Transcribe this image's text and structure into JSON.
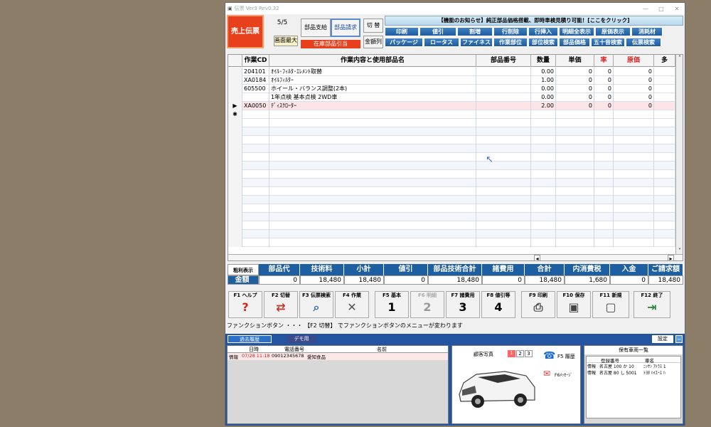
{
  "window": {
    "title": "伝票 Ver3 Rev0.32",
    "controls": [
      "—",
      "□",
      "✕"
    ]
  },
  "header": {
    "sales_slip": "売上伝票",
    "page": "5/5",
    "parts_pay": "部品支給",
    "parts_bill": "部品請求",
    "switch": "切 替",
    "screen_max": "画面最大",
    "stock_draw": "在庫部品引当",
    "all_amounts": "金額列"
  },
  "notice": "【機能のお知らせ】純正部品価格搭載、即時車検見積り可能！[ここをクリック]",
  "toolbar_row1": [
    "印刷",
    "値引",
    "割増",
    "行削除",
    "行挿入",
    "明細全表示",
    "原価表示",
    "消耗材"
  ],
  "toolbar_row2": [
    "パッケージ",
    "ロータス",
    "ファイネス",
    "作業部位",
    "部位検索",
    "部品価格",
    "五十音検索",
    "伝票検索"
  ],
  "grid": {
    "headers": [
      "作業CD",
      "作業内容と使用部品名",
      "部品番号",
      "数量",
      "単価",
      "率",
      "原価",
      "多"
    ],
    "rows": [
      {
        "mark": "",
        "cd": "204101",
        "name": "ｵｲﾙ･ﾌｨﾙﾀ･ｴﾚﾒﾝﾄ取替",
        "part": "",
        "qty": "0.00",
        "price": "0",
        "rate": "0",
        "cost": "0"
      },
      {
        "mark": "",
        "cd": "XA0184",
        "name": "ｵｲﾙﾌｨﾙﾀｰ",
        "part": "",
        "qty": "1.00",
        "price": "0",
        "rate": "0",
        "cost": "0"
      },
      {
        "mark": "",
        "cd": "605500",
        "name": "ホイール・バランス調整(2本)",
        "part": "",
        "qty": "0.00",
        "price": "0",
        "rate": "0",
        "cost": "0"
      },
      {
        "mark": "",
        "cd": "",
        "name": "1年点検 基本点検 2WD車",
        "part": "",
        "qty": "0.00",
        "price": "0",
        "rate": "0",
        "cost": "0"
      },
      {
        "mark": "▶",
        "cd": "XA0050",
        "name": "ﾃﾞｨｽｸﾛｰﾀｰ",
        "part": "",
        "qty": "2.00",
        "price": "0",
        "rate": "0",
        "cost": "0"
      },
      {
        "mark": "✱",
        "cd": "",
        "name": "",
        "part": "",
        "qty": "",
        "price": "",
        "rate": "",
        "cost": ""
      }
    ]
  },
  "totals": {
    "label_top": "粗利表示",
    "label_bottom": "金額",
    "heads": [
      "部品代",
      "技術料",
      "小計",
      "値引",
      "部品技術合計",
      "諸費用",
      "合計",
      "内消費税",
      "入金",
      "ご請求額"
    ],
    "values": [
      "0",
      "18,480",
      "18,480",
      "0",
      "18,480",
      "0",
      "18,480",
      "1,680",
      "0",
      "18,480"
    ]
  },
  "fkeys": [
    {
      "key": "F1 ヘルプ",
      "icon": "?",
      "color": "#d8241a"
    },
    {
      "key": "F2 切替",
      "icon": "⇄",
      "color": "#c0392b"
    },
    {
      "key": "F3 伝票検索",
      "icon": "⌕",
      "color": "#2a6ab0"
    },
    {
      "key": "F4 作業",
      "icon": "✕",
      "color": "#555"
    },
    {
      "key": "F5 基本",
      "icon": "1",
      "color": "#000"
    },
    {
      "key": "F6 明細",
      "icon": "2",
      "color": "#999"
    },
    {
      "key": "F7 諸費用",
      "icon": "3",
      "color": "#000"
    },
    {
      "key": "F8 値引等",
      "icon": "4",
      "color": "#000"
    },
    {
      "key": "F9 印刷",
      "icon": "⎙",
      "color": "#444"
    },
    {
      "key": "F10 保存",
      "icon": "▣",
      "color": "#444"
    },
    {
      "key": "F11 新規",
      "icon": "▢",
      "color": "#444"
    },
    {
      "key": "F12 終了",
      "icon": "⇥",
      "color": "#2a8a3a"
    }
  ],
  "status": "ファンクションボタン ・・・ 【F2 切替】 でファンクションボタンのメニューが変わります",
  "bottom": {
    "tab_history": "過去履歴",
    "tab_demo": "デモ用",
    "settings": "設定",
    "hist_headers": [
      "日時",
      "電話番号",
      "名前"
    ],
    "hist_row": {
      "type": "情報",
      "date": "07/28 11:18",
      "tel": "09012345678",
      "name": "愛知食品"
    },
    "photo_label": "顧客写真",
    "photo_pages": [
      "1",
      "2",
      "3"
    ],
    "f5_history": "F5 履歴",
    "f6_message": "F6ﾒｯｾｰｼﾞ",
    "vehicles_title": "保有車両一覧",
    "veh_headers": [
      "登録番号",
      "車名"
    ],
    "vehicles": [
      {
        "type": "情報",
        "reg": "名古屋 100 か 10",
        "car": "ﾆｯｻﾝ ｱﾄﾗｽ 1"
      },
      {
        "type": "情報",
        "reg": "名古屋 80 し 5001",
        "car": "ﾄﾖﾀ ﾊｲｴｰｽ ﾊ"
      }
    ]
  }
}
